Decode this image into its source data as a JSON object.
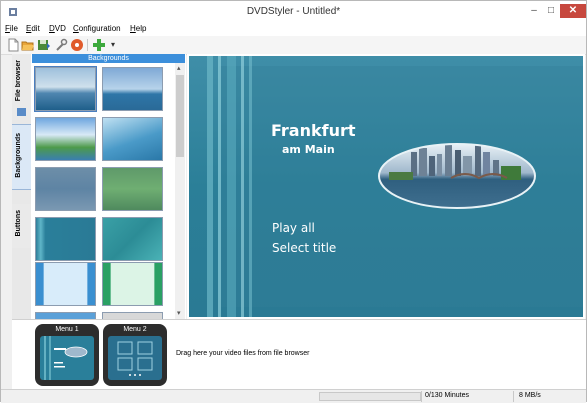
{
  "window": {
    "title": "DVDStyler - Untitled*",
    "min": "–",
    "max": "□",
    "close": "✕"
  },
  "menubar": {
    "items": [
      {
        "label": "File",
        "mnemonic": "F",
        "rest": "ile"
      },
      {
        "label": "Edit",
        "mnemonic": "E",
        "rest": "dit"
      },
      {
        "label": "DVD",
        "mnemonic": "D",
        "rest": "VD"
      },
      {
        "label": "Configuration",
        "mnemonic": "C",
        "rest": "onfiguration"
      },
      {
        "label": "Help",
        "mnemonic": "H",
        "rest": "elp"
      }
    ]
  },
  "toolbar": {
    "icons": [
      "new-icon",
      "open-icon",
      "save-icon",
      "settings-icon",
      "burn-icon",
      "add-icon",
      "dropdown-arrow-icon"
    ],
    "dropdown": "▾"
  },
  "sidebar": {
    "tabs": [
      {
        "label": "File browser",
        "active": false
      },
      {
        "label": "Backgrounds",
        "active": true
      },
      {
        "label": "Buttons",
        "active": false
      }
    ]
  },
  "backgrounds": {
    "header": "Backgrounds",
    "scroll_up": "▴",
    "scroll_down": "▾"
  },
  "menu_preview": {
    "title_line1": "Frankfurt",
    "title_line2": "am Main",
    "button1": "Play all",
    "button2": "Select title"
  },
  "titleset": {
    "menus": [
      {
        "label": "Menu 1"
      },
      {
        "label": "Menu 2"
      }
    ],
    "hint": "Drag here your video files from file browser"
  },
  "status": {
    "duration": "0/130 Minutes",
    "bitrate": "8 MB/s"
  },
  "colors": {
    "accent": "#3c8fdb",
    "canvas_teal": "#2a7f9a",
    "close": "#c7483e"
  }
}
